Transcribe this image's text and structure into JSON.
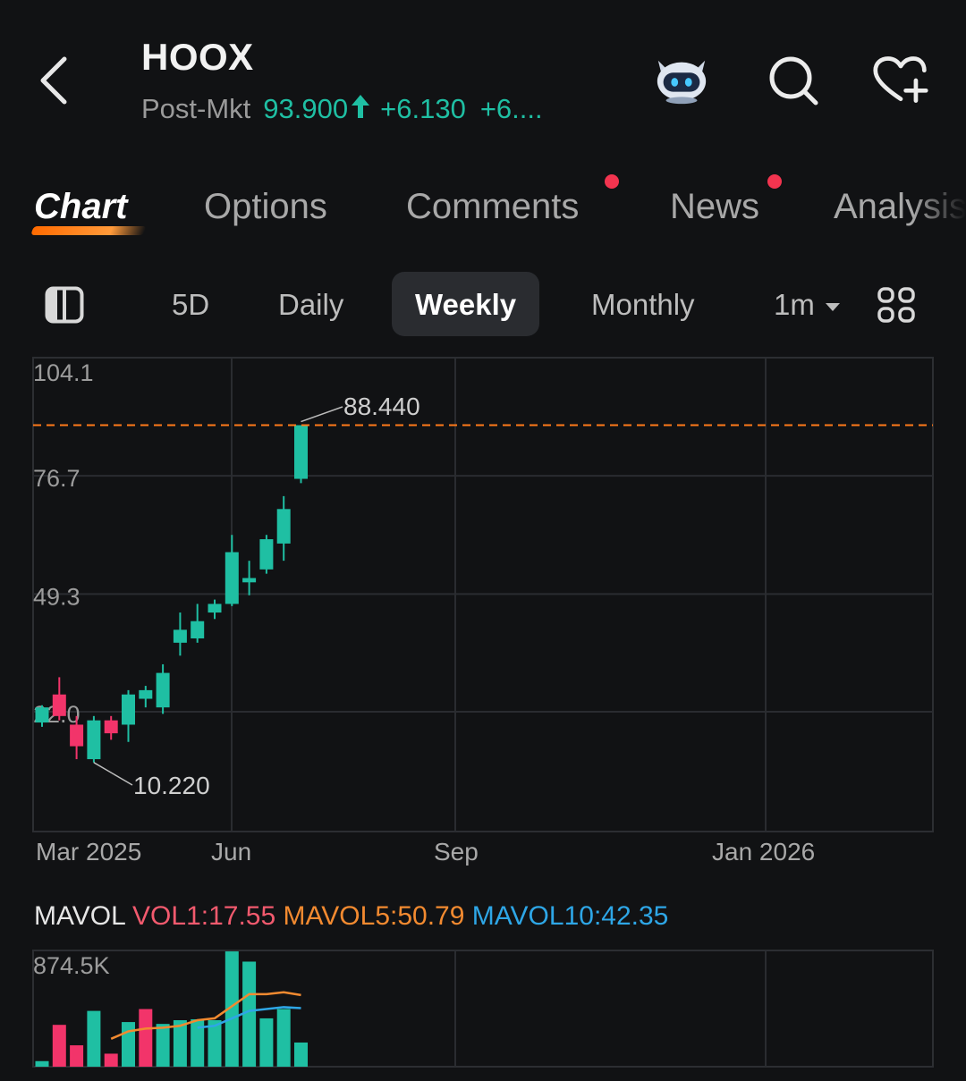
{
  "header": {
    "symbol": "HOOX",
    "session": "Post-Mkt",
    "price": "93.900",
    "change": "+6.130",
    "change_pct": "+6....",
    "up_color": "#1fbfa3"
  },
  "icons": {
    "back": "chevron-left-icon",
    "assistant": "robot-icon",
    "search": "search-icon",
    "watchlist": "heart-plus-icon",
    "layout": "panel-toggle-icon",
    "grid": "grid-icon"
  },
  "tabs": [
    {
      "label": "Chart",
      "active": true,
      "dot": false
    },
    {
      "label": "Options",
      "active": false,
      "dot": false
    },
    {
      "label": "Comments",
      "active": false,
      "dot": true
    },
    {
      "label": "News",
      "active": false,
      "dot": true
    },
    {
      "label": "Analysis",
      "active": false,
      "dot": false
    }
  ],
  "periods": {
    "p5d": "5D",
    "daily": "Daily",
    "weekly": "Weekly",
    "monthly": "Monthly",
    "interval": "1m",
    "selected": "Weekly"
  },
  "chart_data": {
    "type": "candlestick",
    "y_ticks": [
      "104.1",
      "76.7",
      "49.3",
      "22.0"
    ],
    "x_ticks": [
      "Mar 2025",
      "Jun",
      "Sep",
      "Jan 2026"
    ],
    "high_marker": "88.440",
    "low_marker": "10.220",
    "last_price_line": 88.44,
    "colors": {
      "up": "#1fbfa3",
      "down": "#f2346a",
      "price_line": "#ff7a1a"
    },
    "candles": [
      {
        "o": 19.5,
        "c": 23.0,
        "h": 23.5,
        "l": 18.5
      },
      {
        "o": 26.0,
        "c": 21.0,
        "h": 30.0,
        "l": 20.0
      },
      {
        "o": 19.0,
        "c": 14.0,
        "h": 21.0,
        "l": 11.0
      },
      {
        "o": 11.0,
        "c": 20.0,
        "h": 21.0,
        "l": 10.22
      },
      {
        "o": 20.0,
        "c": 17.0,
        "h": 21.0,
        "l": 15.5
      },
      {
        "o": 19.0,
        "c": 26.0,
        "h": 27.0,
        "l": 15.0
      },
      {
        "o": 25.0,
        "c": 27.0,
        "h": 28.0,
        "l": 23.0
      },
      {
        "o": 23.0,
        "c": 31.0,
        "h": 33.0,
        "l": 21.5
      },
      {
        "o": 38.0,
        "c": 41.0,
        "h": 45.0,
        "l": 35.0
      },
      {
        "o": 39.0,
        "c": 43.0,
        "h": 47.0,
        "l": 38.0
      },
      {
        "o": 45.0,
        "c": 47.0,
        "h": 48.0,
        "l": 43.5
      },
      {
        "o": 47.0,
        "c": 59.0,
        "h": 63.0,
        "l": 46.5
      },
      {
        "o": 52.0,
        "c": 53.0,
        "h": 57.0,
        "l": 49.0
      },
      {
        "o": 55.0,
        "c": 62.0,
        "h": 63.0,
        "l": 54.0
      },
      {
        "o": 61.0,
        "c": 69.0,
        "h": 72.0,
        "l": 57.0
      },
      {
        "o": 76.0,
        "c": 88.44,
        "h": 88.44,
        "l": 75.0
      }
    ]
  },
  "volume": {
    "label": "MAVOL",
    "vol1": "VOL1:17.55",
    "mavol5": "MAVOL5:50.79",
    "mavol10": "MAVOL10:42.35",
    "max_label": "874.5K",
    "colors": {
      "label": "#e6e6e6",
      "vol1": "#f25a6e",
      "mavol5": "#f28a30",
      "mavol10": "#2ea6e6"
    },
    "bars": [
      {
        "v": 6,
        "up": true
      },
      {
        "v": 45,
        "up": false
      },
      {
        "v": 23,
        "up": false
      },
      {
        "v": 60,
        "up": true
      },
      {
        "v": 14,
        "up": false
      },
      {
        "v": 48,
        "up": true
      },
      {
        "v": 62,
        "up": false
      },
      {
        "v": 46,
        "up": true
      },
      {
        "v": 50,
        "up": true
      },
      {
        "v": 51,
        "up": true
      },
      {
        "v": 50,
        "up": true
      },
      {
        "v": 124,
        "up": true
      },
      {
        "v": 113,
        "up": true
      },
      {
        "v": 52,
        "up": true
      },
      {
        "v": 62,
        "up": true
      },
      {
        "v": 26,
        "up": true
      }
    ],
    "mavol5_line": [
      null,
      null,
      null,
      null,
      30,
      38,
      41,
      42,
      44,
      50,
      52,
      65,
      78,
      78,
      80,
      77
    ],
    "mavol10_line": [
      null,
      null,
      null,
      null,
      null,
      null,
      null,
      null,
      null,
      42,
      44,
      52,
      60,
      62,
      64,
      63
    ]
  }
}
